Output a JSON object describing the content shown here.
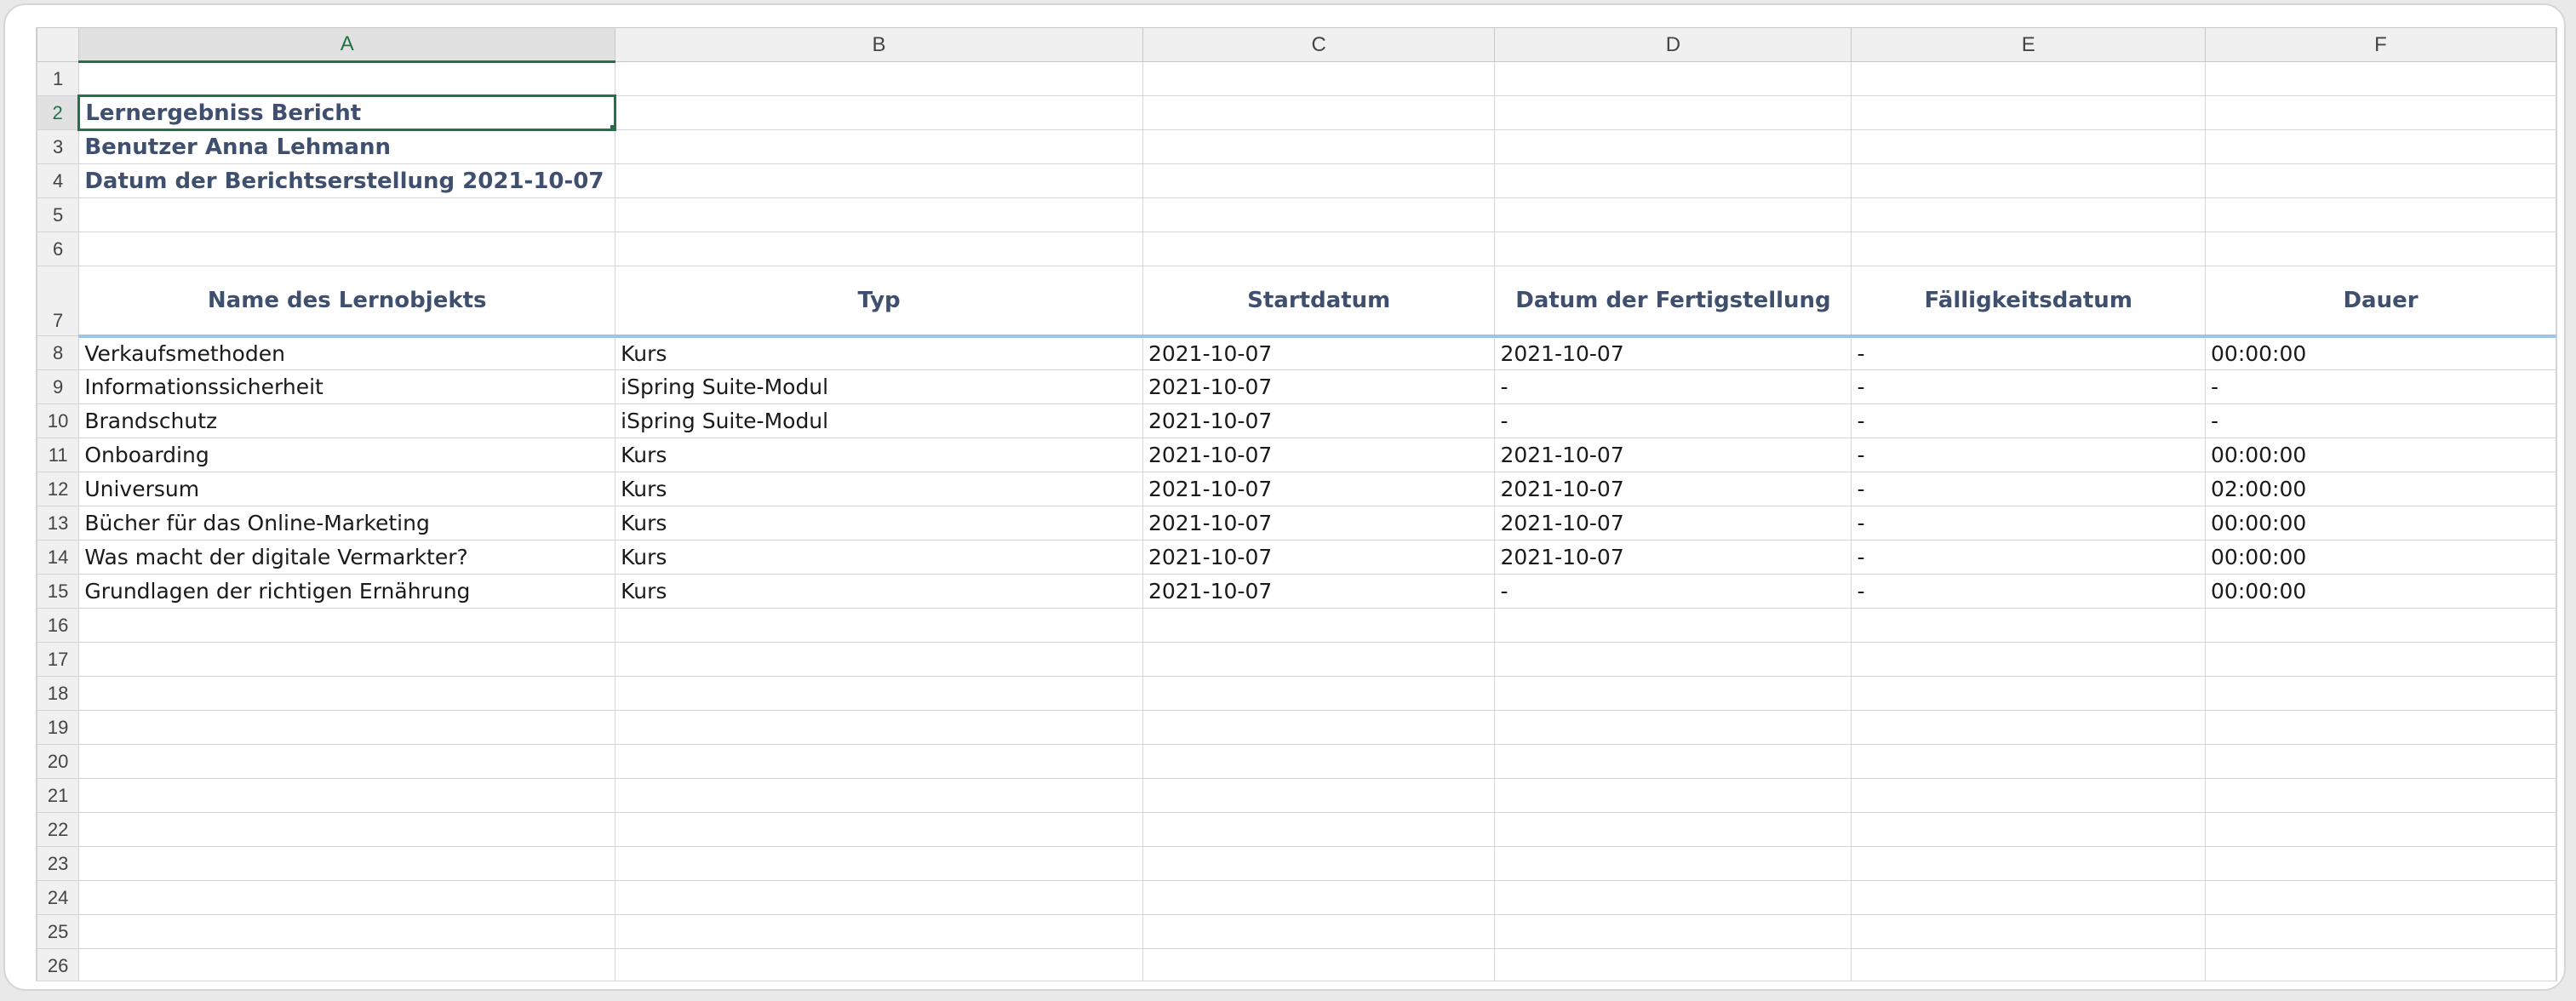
{
  "columns": [
    "A",
    "B",
    "C",
    "D",
    "E",
    "F"
  ],
  "rows": [
    "1",
    "2",
    "3",
    "4",
    "5",
    "6",
    "7",
    "8",
    "9",
    "10",
    "11",
    "12",
    "13",
    "14",
    "15",
    "16",
    "17",
    "18",
    "19",
    "20",
    "21",
    "22",
    "23",
    "24",
    "25",
    "26"
  ],
  "report": {
    "title": "Lernergebniss Bericht",
    "user": "Benutzer Anna Lehmann",
    "date": "Datum der Berichtserstellung 2021-10-07"
  },
  "headers": [
    "Name des Lernobjekts",
    "Typ",
    "Startdatum",
    "Datum der Fertigstellung",
    "Fälligkeitsdatum",
    "Dauer"
  ],
  "data": [
    [
      "Verkaufsmethoden",
      "Kurs",
      "2021-10-07",
      "2021-10-07",
      "-",
      "00:00:00"
    ],
    [
      "Informationssicherheit",
      "iSpring Suite-Modul",
      "2021-10-07",
      "-",
      "-",
      "-"
    ],
    [
      "Brandschutz",
      "iSpring Suite-Modul",
      "2021-10-07",
      "-",
      "-",
      "-"
    ],
    [
      "Onboarding",
      "Kurs",
      "2021-10-07",
      "2021-10-07",
      "-",
      "00:00:00"
    ],
    [
      "Universum",
      "Kurs",
      "2021-10-07",
      "2021-10-07",
      "-",
      "02:00:00"
    ],
    [
      "Bücher für das Online-Marketing",
      "Kurs",
      "2021-10-07",
      "2021-10-07",
      "-",
      "00:00:00"
    ],
    [
      "Was macht der digitale Vermarkter?",
      "Kurs",
      "2021-10-07",
      "2021-10-07",
      "-",
      "00:00:00"
    ],
    [
      "Grundlagen der richtigen Ernährung",
      "Kurs",
      "2021-10-07",
      "-",
      "-",
      "00:00:00"
    ]
  ],
  "selected_cell": "A2",
  "colors": {
    "accent": "#217346",
    "header_text": "#3f4f6e",
    "header_border": "#9dc3e6"
  }
}
